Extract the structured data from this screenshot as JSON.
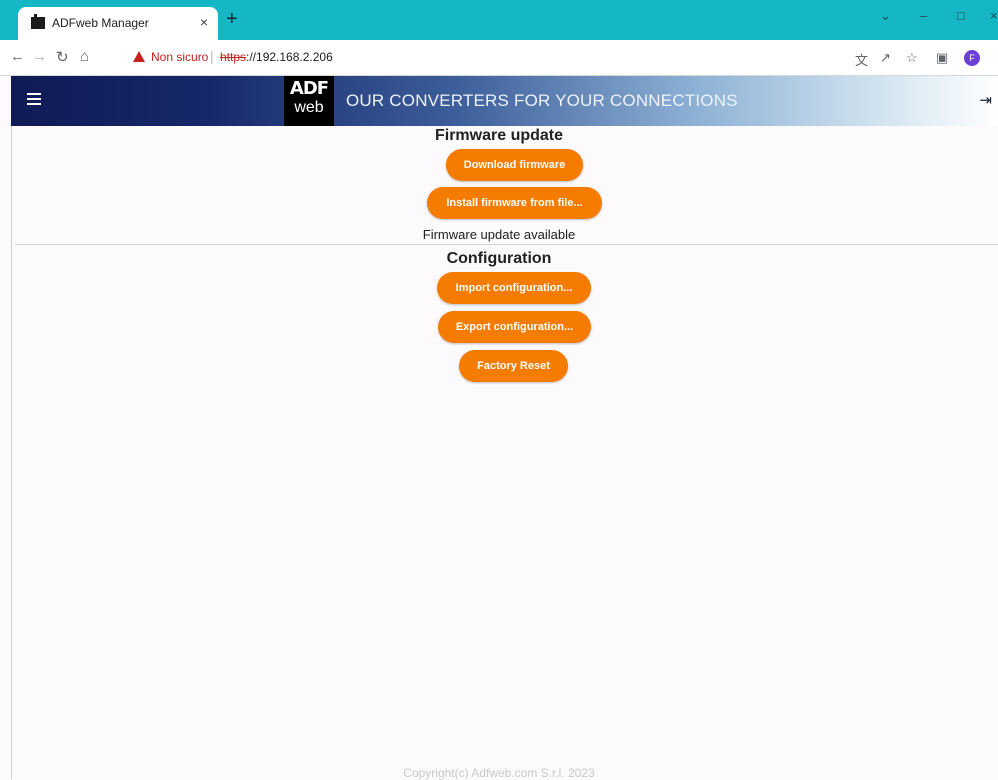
{
  "browser": {
    "tab_title": "ADFweb Manager",
    "tab_close": "×",
    "new_tab": "+",
    "security_warning": "Non sicuro",
    "url_scheme": "https",
    "url_rest": "://192.168.2.206",
    "profile_initial": "F"
  },
  "header": {
    "logo_top": "ADF",
    "logo_bottom": "web",
    "tagline": "OUR CONVERTERS FOR YOUR CONNECTIONS"
  },
  "firmware": {
    "title": "Firmware update",
    "download_label": "Download firmware",
    "install_label": "Install firmware from file...",
    "status": "Firmware update available"
  },
  "configuration": {
    "title": "Configuration",
    "import_label": "Import configuration...",
    "export_label": "Export configuration...",
    "reset_label": "Factory Reset"
  },
  "footer": {
    "copyright": "Copyright(c) Adfweb.com S.r.l. 2023"
  },
  "colors": {
    "accent_button": "#f57c00",
    "tab_strip": "#15b7c4",
    "header_dark": "#101a55"
  }
}
